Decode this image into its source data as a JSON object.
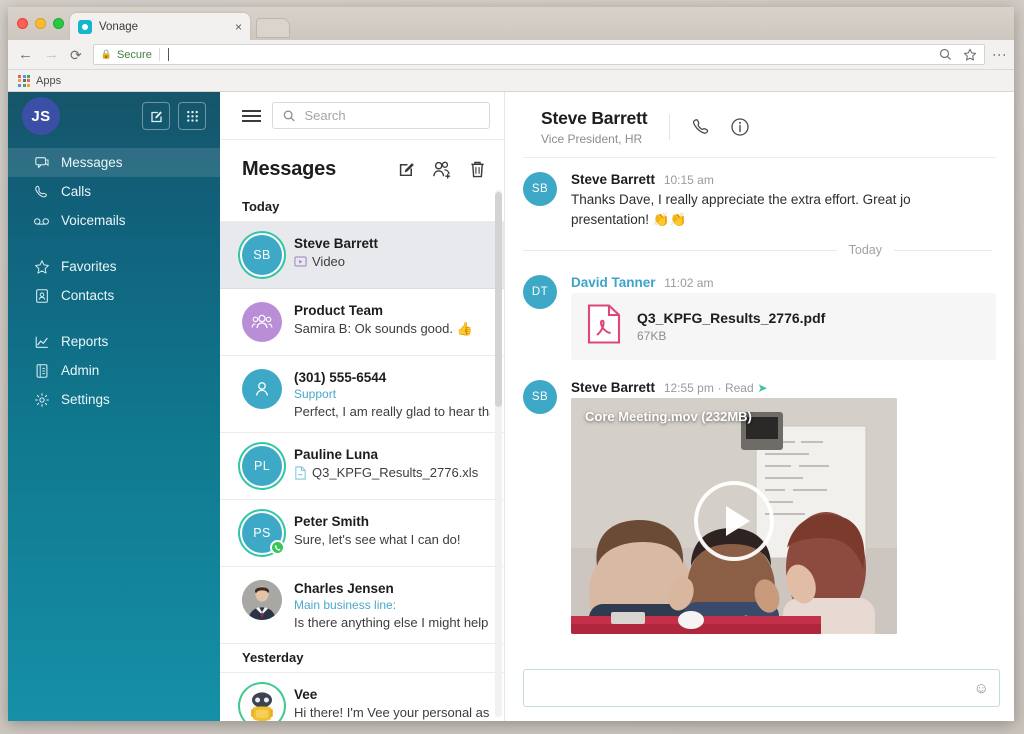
{
  "browser": {
    "tab_title": "Vonage",
    "tab_close": "×",
    "url_security_label": "Secure",
    "bookmark_apps_label": "Apps",
    "back_icon": "←",
    "forward_icon": "→",
    "reload_icon": "⟳",
    "menu_icon": "⋮"
  },
  "sidebar": {
    "avatar_initials": "JS",
    "items": [
      {
        "label": "Messages",
        "icon": "messages-icon",
        "active": true
      },
      {
        "label": "Calls",
        "icon": "phone-icon",
        "active": false
      },
      {
        "label": "Voicemails",
        "icon": "voicemail-icon",
        "active": false
      },
      {
        "label": "Favorites",
        "icon": "star-icon",
        "active": false
      },
      {
        "label": "Contacts",
        "icon": "contacts-icon",
        "active": false
      },
      {
        "label": "Reports",
        "icon": "reports-icon",
        "active": false
      },
      {
        "label": "Admin",
        "icon": "admin-icon",
        "active": false
      },
      {
        "label": "Settings",
        "icon": "gear-icon",
        "active": false
      }
    ],
    "compose_icon": "compose-icon",
    "dialpad_icon": "dialpad-icon"
  },
  "search": {
    "placeholder": "Search",
    "value": ""
  },
  "messages_panel": {
    "title": "Messages",
    "icons": [
      "compose-icon",
      "add-group-icon",
      "trash-icon"
    ],
    "sections": [
      {
        "label": "Today"
      },
      {
        "label": "Yesterday"
      }
    ],
    "conversations": [
      {
        "name": "Steve Barrett",
        "initials": "SB",
        "avatar_color": "#3da9c6",
        "preview": "Video",
        "attachment": "video",
        "selected": true,
        "ring": true
      },
      {
        "name": "Product Team",
        "initials": "",
        "avatar_color": "#b98ed6",
        "preview": "Samira B: Ok sounds good. 👍",
        "selected": false
      },
      {
        "name": "(301) 555-6544",
        "initials": "",
        "avatar_color": "#3da9c6",
        "tag": "Support",
        "preview": "Perfect, I am really glad to hear that!",
        "selected": false
      },
      {
        "name": "Pauline Luna",
        "initials": "PL",
        "avatar_color": "#3da9c6",
        "preview": "Q3_KPFG_Results_2776.xls",
        "attachment": "file",
        "ring": true,
        "selected": false
      },
      {
        "name": "Peter Smith",
        "initials": "PS",
        "avatar_color": "#3da9c6",
        "preview": "Sure, let's see what I can do!",
        "ring": true,
        "badge": "phone",
        "selected": false
      },
      {
        "name": "Charles Jensen",
        "initials": "",
        "avatar_color": "#9aa3a8",
        "tag": "Main business line:",
        "preview": "Is there anything else I might help yo",
        "photo": true,
        "selected": false
      },
      {
        "name": "Vee",
        "initials": "",
        "avatar_color": "#f3c03a",
        "preview": "Hi there! I'm Vee your personal assis",
        "ring": true,
        "bot": true,
        "selected": false
      }
    ]
  },
  "chat": {
    "contact_name": "Steve Barrett",
    "contact_role": "Vice President, HR",
    "header_icons": [
      "phone-icon",
      "info-icon"
    ],
    "day_divider": "Today",
    "messages": [
      {
        "author": "Steve Barrett",
        "initials": "SB",
        "avatar_color": "#3da9c6",
        "time": "10:15 am",
        "text_line1": "Thanks Dave, I really appreciate the extra effort. Great jo",
        "text_line2": "presentation! 👏👏",
        "type": "text"
      },
      {
        "author": "David Tanner",
        "initials": "DT",
        "avatar_color": "#3da9c6",
        "time": "11:02 am",
        "type": "file",
        "file_name": "Q3_KPFG_Results_2776.pdf",
        "file_size": "67KB"
      },
      {
        "author": "Steve Barrett",
        "initials": "SB",
        "avatar_color": "#3da9c6",
        "time": "12:55 pm",
        "read_status": "· Read",
        "type": "video",
        "video_label": "Core Meeting.mov (232MB)"
      }
    ],
    "composer": {
      "placeholder": "",
      "value": "",
      "emoji_icon": "emoji-icon"
    }
  },
  "colors": {
    "sidebar_top": "#16556a",
    "sidebar_bottom": "#1590a8",
    "avatar_js": "#3c4fa6",
    "accent_blue": "#3ba4c9",
    "pdf_red": "#e0457b",
    "selected_row": "#e8e9ec"
  }
}
